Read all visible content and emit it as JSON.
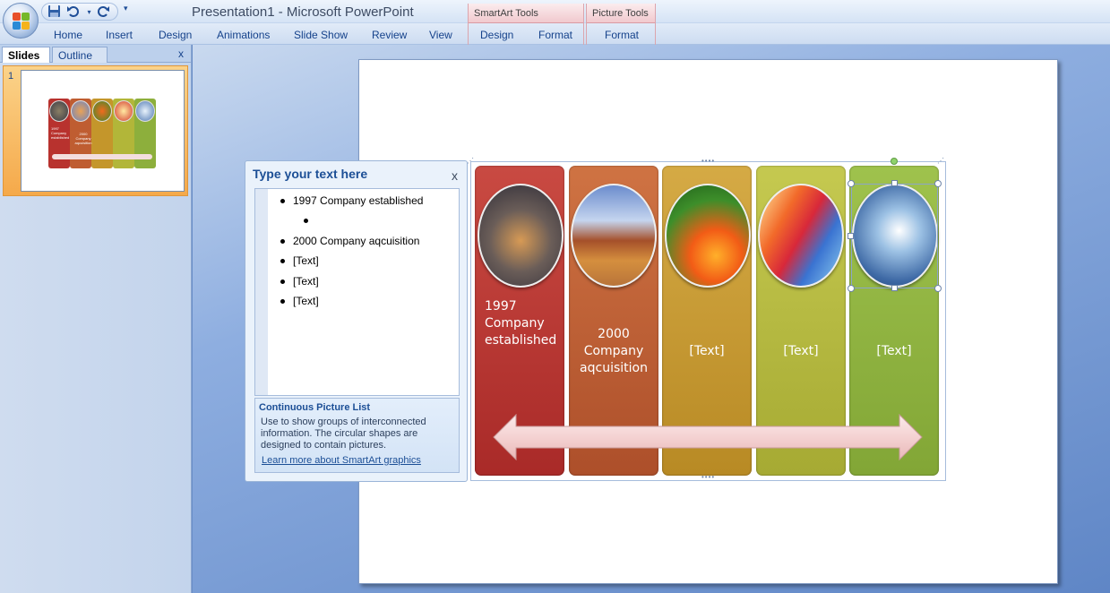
{
  "window": {
    "title": "Presentation1 - Microsoft PowerPoint"
  },
  "quick_access": {
    "save_icon": "save-icon",
    "undo_icon": "undo-icon",
    "redo_icon": "redo-icon",
    "more": "▾"
  },
  "ribbon": {
    "tabs": [
      "Home",
      "Insert",
      "Design",
      "Animations",
      "Slide Show",
      "Review",
      "View"
    ],
    "contextual": {
      "smartart": {
        "title": "SmartArt Tools",
        "tabs": [
          "Design",
          "Format"
        ]
      },
      "picture": {
        "title": "Picture Tools",
        "tabs": [
          "Format"
        ]
      }
    }
  },
  "slides_pane": {
    "tabs": {
      "slides": "Slides",
      "outline": "Outline"
    },
    "close": "x",
    "slide_number": "1",
    "thumbnail_texts": [
      "1997 Company established",
      "2000 Company aqcuisition"
    ]
  },
  "text_pane": {
    "title": "Type your text here",
    "close": "x",
    "bullets": [
      "1997 Company established",
      "",
      "2000 Company aqcuisition",
      "[Text]",
      "[Text]",
      "[Text]"
    ],
    "info": {
      "title": "Continuous Picture List",
      "description": "Use to show groups of interconnected information. The circular shapes are designed to contain pictures.",
      "link": "Learn more about SmartArt graphics"
    }
  },
  "smartart": {
    "items": [
      {
        "lines": [
          "1997",
          "Company",
          "established"
        ],
        "color": "#b8322e",
        "image": "city-night-photo"
      },
      {
        "lines": [
          "2000",
          "Company",
          "aqcuisition"
        ],
        "color": "#bf5d31",
        "image": "desert-monument-photo"
      },
      {
        "lines": [
          "[Text]"
        ],
        "color": "#c4962b",
        "image": "butterfly-flower-photo"
      },
      {
        "lines": [
          "[Text]"
        ],
        "color": "#b2b639",
        "image": "abstract-color-photo"
      },
      {
        "lines": [
          "[Text]"
        ],
        "color": "#8daf3c",
        "image": "surfer-wave-photo"
      }
    ]
  },
  "colors": {
    "ribbon_text": "#15428b",
    "workspace": "#6a8ec7"
  }
}
